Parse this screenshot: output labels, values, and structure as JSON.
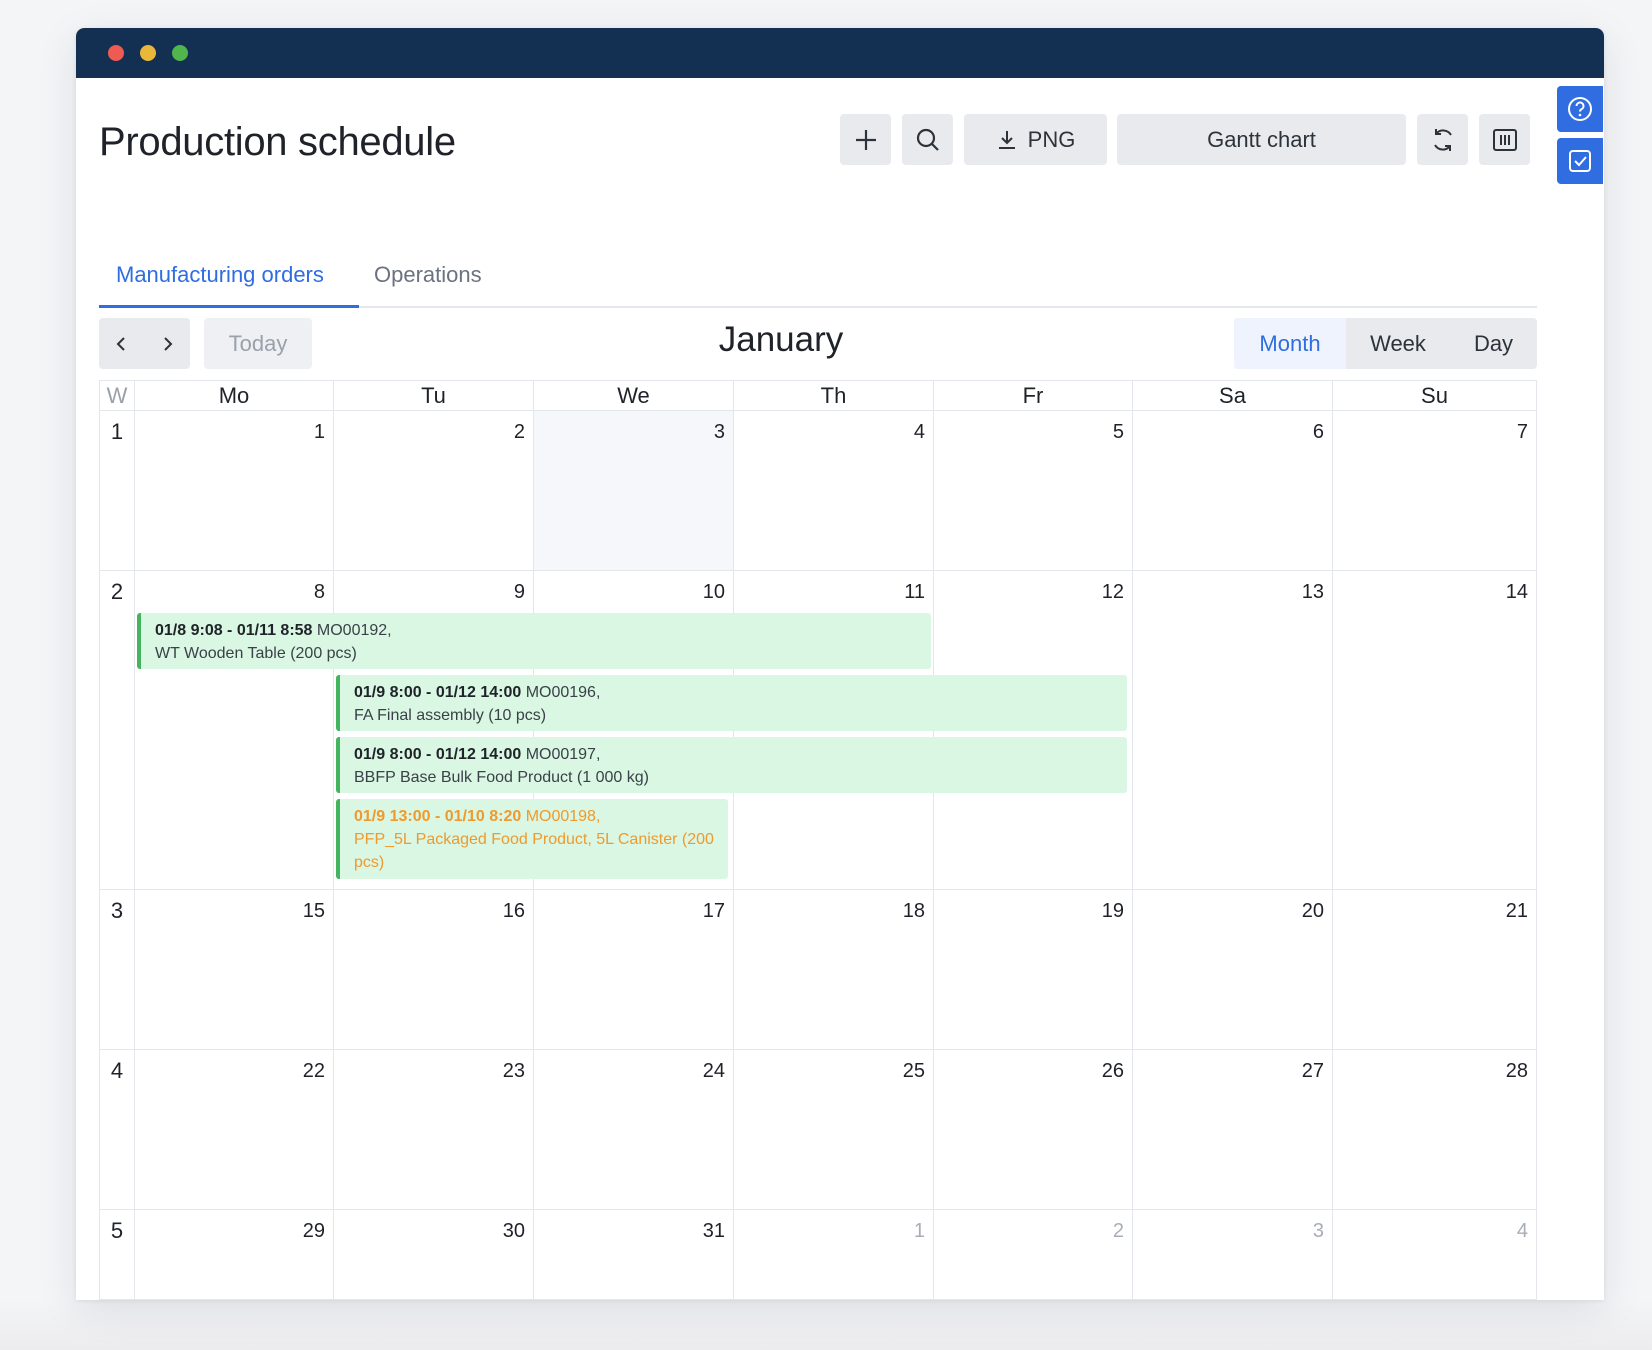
{
  "page": {
    "title": "Production schedule"
  },
  "toolbar": {
    "png_label": "PNG",
    "gantt_label": "Gantt chart"
  },
  "tabs": [
    {
      "label": "Manufacturing orders",
      "active": true
    },
    {
      "label": "Operations",
      "active": false
    }
  ],
  "calendar": {
    "today_label": "Today",
    "month": "January",
    "views": [
      "Month",
      "Week",
      "Day"
    ],
    "active_view": "Month",
    "week_header": "W",
    "weekdays": [
      "Mo",
      "Tu",
      "We",
      "Th",
      "Fr",
      "Sa",
      "Su"
    ],
    "weeks": [
      {
        "num": "1",
        "days": [
          "1",
          "2",
          "3",
          "4",
          "5",
          "6",
          "7"
        ]
      },
      {
        "num": "2",
        "days": [
          "8",
          "9",
          "10",
          "11",
          "12",
          "13",
          "14"
        ]
      },
      {
        "num": "3",
        "days": [
          "15",
          "16",
          "17",
          "18",
          "19",
          "20",
          "21"
        ]
      },
      {
        "num": "4",
        "days": [
          "22",
          "23",
          "24",
          "25",
          "26",
          "27",
          "28"
        ]
      },
      {
        "num": "5",
        "days": [
          "29",
          "30",
          "31",
          "1",
          "2",
          "3",
          "4"
        ]
      }
    ],
    "events": [
      {
        "range": "01/8 9:08 - 01/11 8:58",
        "order": "MO00192,",
        "product": "WT Wooden Table (200 pcs)",
        "status": "ok"
      },
      {
        "range": "01/9 8:00 - 01/12 14:00",
        "order": "MO00196,",
        "product": "FA Final assembly (10 pcs)",
        "status": "ok"
      },
      {
        "range": "01/9 8:00 - 01/12 14:00",
        "order": "MO00197,",
        "product": "BBFP Base Bulk Food Product (1 000 kg)",
        "status": "ok"
      },
      {
        "range": "01/9 13:00 - 01/10 8:20",
        "order": "MO00198,",
        "product": "PFP_5L Packaged Food Product, 5L Canister (200 pcs)",
        "status": "warning"
      }
    ]
  },
  "colors": {
    "accent": "#2f6de0",
    "titlebar": "#132f52",
    "event_bg": "#d9f7e3",
    "event_border": "#44b45e",
    "warning": "#ee9a2e"
  }
}
